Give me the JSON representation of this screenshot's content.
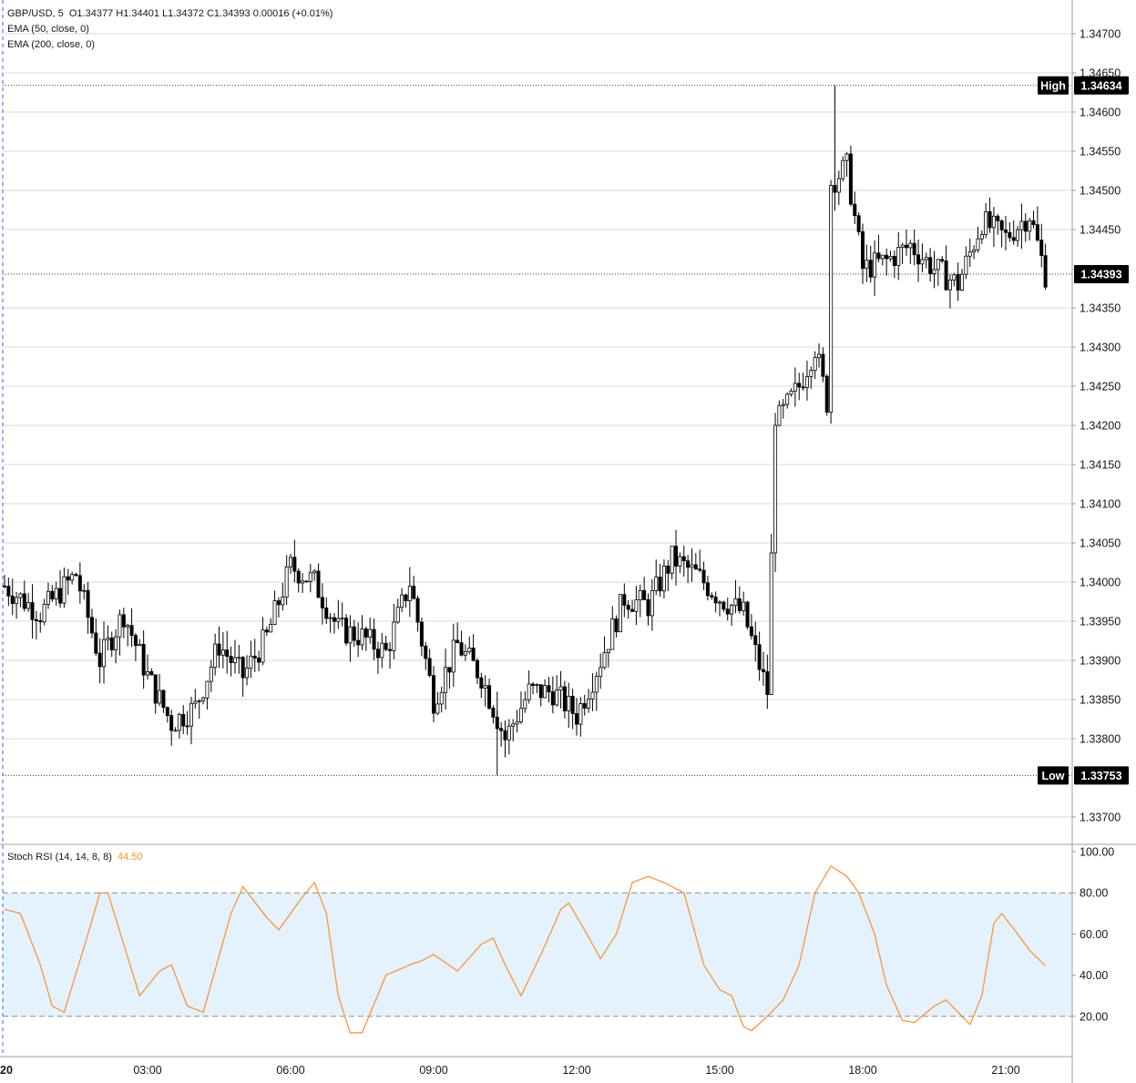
{
  "header": {
    "symbol": "GBP/USD, 5",
    "ohlc": "O1.34377  H1.34401  L1.34372  C1.34393  0.00016 (+0.01%)",
    "ema50": "EMA (50, close, 0)",
    "ema200": "EMA (200, close, 0)"
  },
  "rsi_panel": {
    "title": "Stoch RSI (14, 14, 8, 8)",
    "value": "44.50"
  },
  "markers": {
    "high_label": "High",
    "high_value": "1.34634",
    "low_label": "Low",
    "low_value": "1.33753",
    "last_value": "1.34393"
  },
  "colors": {
    "candle_up": "#ffffff",
    "candle_down": "#000000",
    "rsi_line": "#ff8c24",
    "rsi_band": "#e3f2fd",
    "grid": "#d9d9d9"
  },
  "chart_data": [
    {
      "type": "candlestick",
      "symbol": "GBP/USD",
      "timeframe": "5",
      "price_ticks": [
        "1.34700",
        "1.34650",
        "1.34600",
        "1.34550",
        "1.34500",
        "1.34450",
        "1.34350",
        "1.34300",
        "1.34250",
        "1.34200",
        "1.34150",
        "1.34100",
        "1.34050",
        "1.34000",
        "1.33950",
        "1.33900",
        "1.33850",
        "1.33800",
        "1.33700"
      ],
      "x_ticks": [
        "20",
        "03:00",
        "06:00",
        "09:00",
        "12:00",
        "15:00",
        "18:00",
        "21:00"
      ],
      "ylim": [
        1.3367,
        1.3474
      ],
      "high": 1.34634,
      "low": 1.33753,
      "last": 1.34393,
      "approx_path": [
        {
          "x": "00:00",
          "y": 1.33995
        },
        {
          "x": "00:45",
          "y": 1.3396
        },
        {
          "x": "01:30",
          "y": 1.3401
        },
        {
          "x": "02:00",
          "y": 1.339
        },
        {
          "x": "02:30",
          "y": 1.3396
        },
        {
          "x": "03:00",
          "y": 1.3388
        },
        {
          "x": "03:30",
          "y": 1.3382
        },
        {
          "x": "04:00",
          "y": 1.3384
        },
        {
          "x": "04:30",
          "y": 1.3392
        },
        {
          "x": "05:00",
          "y": 1.3388
        },
        {
          "x": "05:30",
          "y": 1.3393
        },
        {
          "x": "06:00",
          "y": 1.3402
        },
        {
          "x": "06:30",
          "y": 1.34
        },
        {
          "x": "07:00",
          "y": 1.3394
        },
        {
          "x": "07:30",
          "y": 1.3393
        },
        {
          "x": "08:00",
          "y": 1.3391
        },
        {
          "x": "08:30",
          "y": 1.34
        },
        {
          "x": "09:00",
          "y": 1.3385
        },
        {
          "x": "09:30",
          "y": 1.3392
        },
        {
          "x": "10:00",
          "y": 1.3388
        },
        {
          "x": "10:30",
          "y": 1.338
        },
        {
          "x": "11:00",
          "y": 1.3386
        },
        {
          "x": "11:30",
          "y": 1.3386
        },
        {
          "x": "12:00",
          "y": 1.3383
        },
        {
          "x": "12:30",
          "y": 1.339
        },
        {
          "x": "13:00",
          "y": 1.3398
        },
        {
          "x": "13:30",
          "y": 1.3397
        },
        {
          "x": "14:00",
          "y": 1.3403
        },
        {
          "x": "14:30",
          "y": 1.3401
        },
        {
          "x": "15:00",
          "y": 1.3398
        },
        {
          "x": "15:30",
          "y": 1.3396
        },
        {
          "x": "16:00",
          "y": 1.3386
        },
        {
          "x": "16:10",
          "y": 1.342
        },
        {
          "x": "16:40",
          "y": 1.3425
        },
        {
          "x": "17:00",
          "y": 1.343
        },
        {
          "x": "17:15",
          "y": 1.3423
        },
        {
          "x": "17:20",
          "y": 1.3451
        },
        {
          "x": "17:40",
          "y": 1.3453
        },
        {
          "x": "18:00",
          "y": 1.344
        },
        {
          "x": "18:30",
          "y": 1.3441
        },
        {
          "x": "19:00",
          "y": 1.3443
        },
        {
          "x": "19:30",
          "y": 1.344
        },
        {
          "x": "20:00",
          "y": 1.3438
        },
        {
          "x": "20:30",
          "y": 1.3446
        },
        {
          "x": "21:00",
          "y": 1.3444
        },
        {
          "x": "21:30",
          "y": 1.3447
        },
        {
          "x": "21:50",
          "y": 1.34393
        }
      ]
    },
    {
      "type": "line",
      "title": "Stoch RSI (14, 14, 8, 8)",
      "y_ticks": [
        "100.00",
        "80.00",
        "60.00",
        "40.00",
        "20.00"
      ],
      "ylim": [
        0,
        100
      ],
      "band": [
        20,
        80
      ],
      "series": [
        {
          "values_approx": [
            {
              "x": "00:00",
              "y": 72
            },
            {
              "x": "00:20",
              "y": 70
            },
            {
              "x": "00:45",
              "y": 45
            },
            {
              "x": "01:00",
              "y": 25
            },
            {
              "x": "01:15",
              "y": 22
            },
            {
              "x": "01:45",
              "y": 60
            },
            {
              "x": "02:00",
              "y": 80
            },
            {
              "x": "02:10",
              "y": 80
            },
            {
              "x": "02:30",
              "y": 55
            },
            {
              "x": "02:50",
              "y": 30
            },
            {
              "x": "03:15",
              "y": 42
            },
            {
              "x": "03:30",
              "y": 45
            },
            {
              "x": "03:50",
              "y": 25
            },
            {
              "x": "04:10",
              "y": 22
            },
            {
              "x": "04:45",
              "y": 70
            },
            {
              "x": "05:00",
              "y": 83
            },
            {
              "x": "05:30",
              "y": 68
            },
            {
              "x": "05:45",
              "y": 62
            },
            {
              "x": "06:15",
              "y": 78
            },
            {
              "x": "06:30",
              "y": 85
            },
            {
              "x": "06:45",
              "y": 70
            },
            {
              "x": "07:00",
              "y": 30
            },
            {
              "x": "07:15",
              "y": 12
            },
            {
              "x": "07:30",
              "y": 12
            },
            {
              "x": "08:00",
              "y": 40
            },
            {
              "x": "08:30",
              "y": 45
            },
            {
              "x": "08:45",
              "y": 47
            },
            {
              "x": "09:00",
              "y": 50
            },
            {
              "x": "09:15",
              "y": 46
            },
            {
              "x": "09:30",
              "y": 42
            },
            {
              "x": "10:00",
              "y": 55
            },
            {
              "x": "10:15",
              "y": 58
            },
            {
              "x": "10:30",
              "y": 45
            },
            {
              "x": "10:50",
              "y": 30
            },
            {
              "x": "11:15",
              "y": 50
            },
            {
              "x": "11:40",
              "y": 72
            },
            {
              "x": "11:50",
              "y": 75
            },
            {
              "x": "12:10",
              "y": 62
            },
            {
              "x": "12:30",
              "y": 48
            },
            {
              "x": "12:50",
              "y": 60
            },
            {
              "x": "13:10",
              "y": 85
            },
            {
              "x": "13:30",
              "y": 88
            },
            {
              "x": "13:50",
              "y": 85
            },
            {
              "x": "14:15",
              "y": 80
            },
            {
              "x": "14:40",
              "y": 45
            },
            {
              "x": "15:00",
              "y": 33
            },
            {
              "x": "15:15",
              "y": 30
            },
            {
              "x": "15:30",
              "y": 15
            },
            {
              "x": "15:40",
              "y": 13
            },
            {
              "x": "16:00",
              "y": 20
            },
            {
              "x": "16:20",
              "y": 28
            },
            {
              "x": "16:40",
              "y": 45
            },
            {
              "x": "17:00",
              "y": 80
            },
            {
              "x": "17:20",
              "y": 93
            },
            {
              "x": "17:40",
              "y": 88
            },
            {
              "x": "17:55",
              "y": 80
            },
            {
              "x": "18:15",
              "y": 60
            },
            {
              "x": "18:30",
              "y": 35
            },
            {
              "x": "18:50",
              "y": 18
            },
            {
              "x": "19:05",
              "y": 17
            },
            {
              "x": "19:30",
              "y": 25
            },
            {
              "x": "19:45",
              "y": 28
            },
            {
              "x": "20:00",
              "y": 22
            },
            {
              "x": "20:15",
              "y": 16
            },
            {
              "x": "20:30",
              "y": 30
            },
            {
              "x": "20:45",
              "y": 65
            },
            {
              "x": "20:55",
              "y": 70
            },
            {
              "x": "21:15",
              "y": 60
            },
            {
              "x": "21:30",
              "y": 52
            },
            {
              "x": "21:50",
              "y": 44.5
            }
          ]
        }
      ]
    }
  ]
}
